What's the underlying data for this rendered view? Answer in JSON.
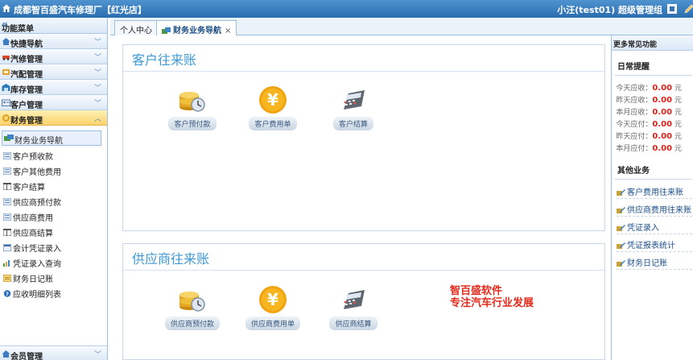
{
  "app": {
    "title": "成都智百盛汽车修理厂【红光店】",
    "user": "小汪(test01)  超级管理组"
  },
  "sidebar": {
    "header": "功能菜单",
    "sections": [
      {
        "label": "快捷导航"
      },
      {
        "label": "汽修管理"
      },
      {
        "label": "汽配管理"
      },
      {
        "label": "库存管理"
      },
      {
        "label": "客户管理"
      },
      {
        "label": "财务管理"
      }
    ],
    "current": "财务业务导航",
    "items": [
      {
        "label": "客户预收款"
      },
      {
        "label": "客户其他费用"
      },
      {
        "label": "客户结算"
      },
      {
        "label": "供应商预付款"
      },
      {
        "label": "供应商费用"
      },
      {
        "label": "供应商结算"
      },
      {
        "label": "会计凭证录入"
      },
      {
        "label": "凭证录入查询"
      },
      {
        "label": "财务日记账"
      },
      {
        "label": "应收明细列表"
      }
    ],
    "bottom": "会员管理"
  },
  "tabs": [
    {
      "label": "个人中心"
    },
    {
      "label": "财务业务导航",
      "close": "×"
    }
  ],
  "main": {
    "customer_panel": {
      "title": "客户往来账",
      "buttons": [
        {
          "label": "客户预付款",
          "icon": "coin-clock-icon"
        },
        {
          "label": "客户费用单",
          "icon": "yen-coin-icon"
        },
        {
          "label": "客户结算",
          "icon": "calculator-icon"
        }
      ]
    },
    "supplier_panel": {
      "title": "供应商往来账",
      "buttons": [
        {
          "label": "供应商预付款",
          "icon": "coin-clock-icon"
        },
        {
          "label": "供应商费用单",
          "icon": "yen-coin-icon"
        },
        {
          "label": "供应商结算",
          "icon": "calculator-icon"
        }
      ]
    },
    "promo": {
      "line1": "智百盛软件",
      "line2": "专注汽车行业发展"
    }
  },
  "right": {
    "header": "更多常见功能",
    "reminder_title": "日常提醒",
    "stats": [
      {
        "label": "今天应收：",
        "value": "0.00",
        "unit": "元"
      },
      {
        "label": "昨天应收：",
        "value": "0.00",
        "unit": "元"
      },
      {
        "label": "本月应收：",
        "value": "0.00",
        "unit": "元"
      },
      {
        "label": "今天应付：",
        "value": "0.00",
        "unit": "元"
      },
      {
        "label": "昨天应付：",
        "value": "0.00",
        "unit": "元"
      },
      {
        "label": "本月应付：",
        "value": "0.00",
        "unit": "元"
      }
    ],
    "other_title": "其他业务",
    "links": [
      {
        "label": "客户费用往来账"
      },
      {
        "label": "供应商费用往来账"
      },
      {
        "label": "凭证录入"
      },
      {
        "label": "凭证报表统计"
      },
      {
        "label": "财务日记账"
      }
    ]
  }
}
